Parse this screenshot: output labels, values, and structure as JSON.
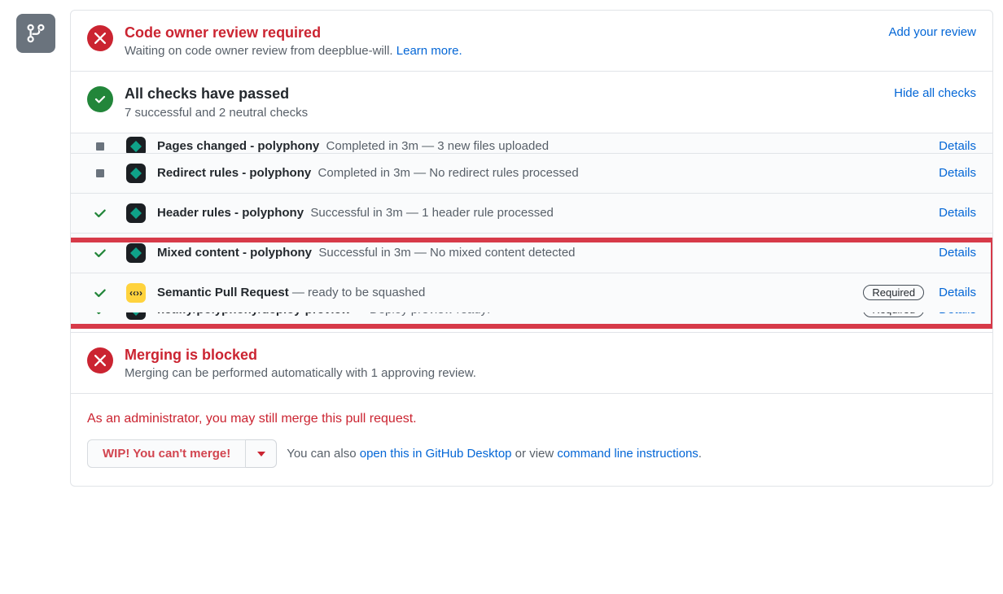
{
  "review": {
    "title": "Code owner review required",
    "subtitle_pre": "Waiting on code owner review from deepblue-will. ",
    "learn_more": "Learn more.",
    "add_review": "Add your review"
  },
  "checks_header": {
    "title": "All checks have passed",
    "subtitle": "7 successful and 2 neutral checks",
    "hide": "Hide all checks"
  },
  "checks": [
    {
      "status": "neutral",
      "avatar": "dark",
      "name": "Pages changed - polyphony",
      "desc": "Completed in 3m — 3 new files uploaded",
      "required": false
    },
    {
      "status": "neutral",
      "avatar": "dark",
      "name": "Redirect rules - polyphony",
      "desc": "Completed in 3m — No redirect rules processed",
      "required": false
    },
    {
      "status": "success",
      "avatar": "dark",
      "name": "Header rules - polyphony",
      "desc": "Successful in 3m — 1 header rule processed",
      "required": false
    },
    {
      "status": "success",
      "avatar": "dark",
      "name": "Mixed content - polyphony",
      "desc": "Successful in 3m — No mixed content detected",
      "required": false
    },
    {
      "status": "success",
      "avatar": "yellow",
      "name": "Semantic Pull Request",
      "desc": " — ready to be squashed",
      "required": true
    },
    {
      "status": "success",
      "avatar": "dark",
      "name": "netlify/polyphony/deploy-preview",
      "desc": " — Deploy preview ready!",
      "required": true
    }
  ],
  "labels": {
    "required": "Required",
    "details": "Details"
  },
  "blocked": {
    "title": "Merging is blocked",
    "subtitle": "Merging can be performed automatically with 1 approving review."
  },
  "admin": {
    "note": "As an administrator, you may still merge this pull request.",
    "button": "WIP! You can't merge!",
    "text_pre": "You can also ",
    "desktop": "open this in GitHub Desktop",
    "text_mid": " or view ",
    "cli": "command line instructions",
    "text_post": "."
  }
}
